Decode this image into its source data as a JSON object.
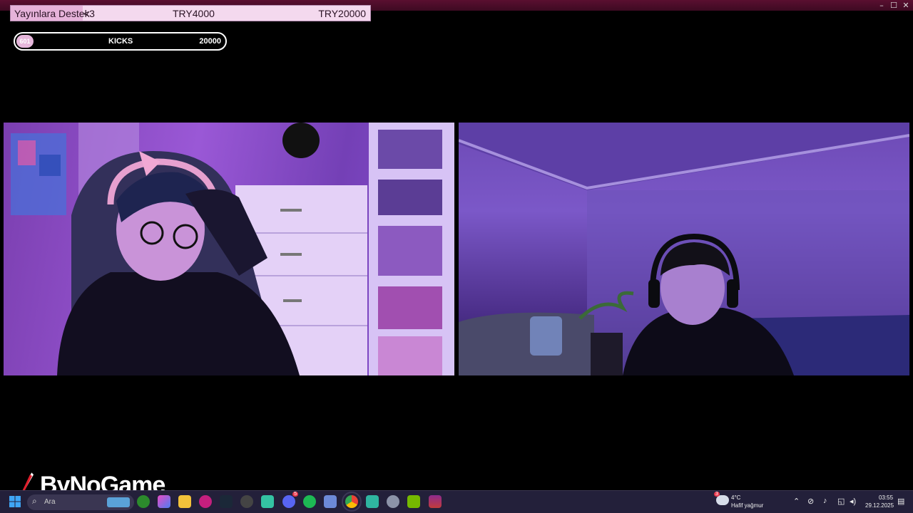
{
  "window": {
    "minimize": "–",
    "maximize": "☐",
    "close": "✕"
  },
  "donation_bar": {
    "title": "Yayınlara Destek",
    "heart": "<3",
    "current": "TRY4000",
    "goal": "TRY20000",
    "progress": 0.2,
    "colors": {
      "fill": "#e6b3da",
      "track": "#f4d9ee"
    }
  },
  "kicks_bar": {
    "current": "601",
    "label": "KICKS",
    "goal": "20000",
    "progress": 0.03
  },
  "cameras": [
    {
      "id": "cam-left",
      "description_icon": "webcam-feed"
    },
    {
      "id": "cam-right",
      "description_icon": "webcam-feed"
    }
  ],
  "logo": {
    "text": "ByNoGame"
  },
  "taskbar": {
    "search_placeholder": "Ara",
    "apps": [
      "windows-start-icon",
      "search-icon",
      "widgets-icon",
      "xbox-icon",
      "copilot-icon",
      "file-explorer-icon",
      "obs-icon",
      "steam-icon",
      "github-icon",
      "app-icon",
      "discord-icon",
      "spotify-icon",
      "app-icon-2",
      "chrome-icon",
      "app-icon-3",
      "settings-icon",
      "nvidia-icon",
      "winrar-icon"
    ],
    "discord_badge": "5",
    "weather": {
      "temp": "4°C",
      "desc": "Hafif yağmur",
      "badge": "3"
    },
    "clock": {
      "time": "03:55",
      "date": "29.12.2025"
    }
  }
}
